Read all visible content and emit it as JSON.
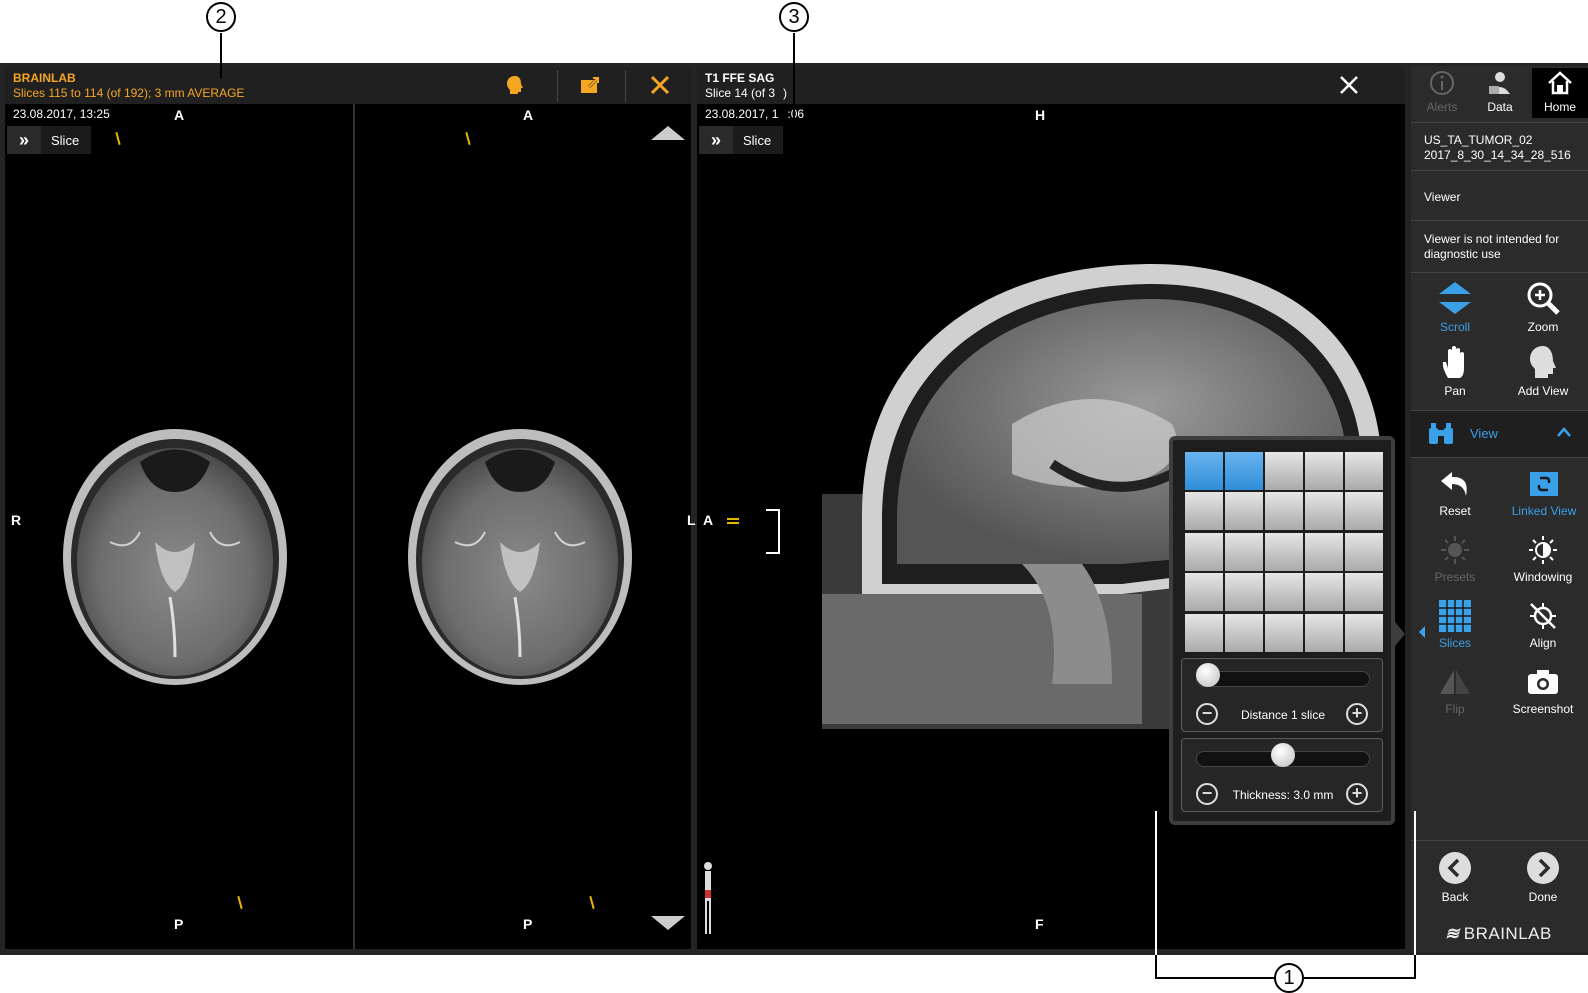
{
  "callouts": {
    "c1": "1",
    "c2": "2",
    "c3": "3"
  },
  "left_panel": {
    "title": "BRAINLAB",
    "subtitle": "Slices 115 to 114 (of 192); 3 mm AVERAGE",
    "date": "23.08.2017, 13:25",
    "slice_label": "Slice",
    "vp1": {
      "top": "A",
      "bottom": "P",
      "left": "R"
    },
    "vp2": {
      "top": "A",
      "bottom": "P",
      "right": "L"
    }
  },
  "right_panel": {
    "title": "T1 FFE SAG",
    "subtitle": "Slice 14 (of 3",
    "subtitle_tail": ")",
    "date": "23.08.2017, 1",
    "date_tail": ":06",
    "slice_label": "Slice",
    "orient": {
      "top": "H",
      "bottom": "F",
      "left": "A"
    }
  },
  "sidebar": {
    "alerts": "Alerts",
    "data": "Data",
    "home": "Home",
    "patient_line1": "US_TA_TUMOR_02",
    "patient_line2": "2017_8_30_14_34_28_516",
    "viewer": "Viewer",
    "disclaimer": "Viewer is not intended for diagnostic use",
    "scroll": "Scroll",
    "zoom": "Zoom",
    "pan": "Pan",
    "add_view": "Add View",
    "view_section": "View",
    "reset": "Reset",
    "linked_view": "Linked View",
    "presets": "Presets",
    "windowing": "Windowing",
    "slices": "Slices",
    "align": "Align",
    "flip": "Flip",
    "screenshot": "Screenshot",
    "back": "Back",
    "done": "Done",
    "logo": "BRAINLAB"
  },
  "popup": {
    "layout_selected": "2 of 25",
    "distance_label": "Distance 1 slice",
    "thickness_label": "Thickness: 3.0 mm",
    "distance_level": 0.05,
    "thickness_level": 0.5
  },
  "colors": {
    "accent_orange": "#f5a623",
    "accent_blue": "#3aa0e8"
  }
}
